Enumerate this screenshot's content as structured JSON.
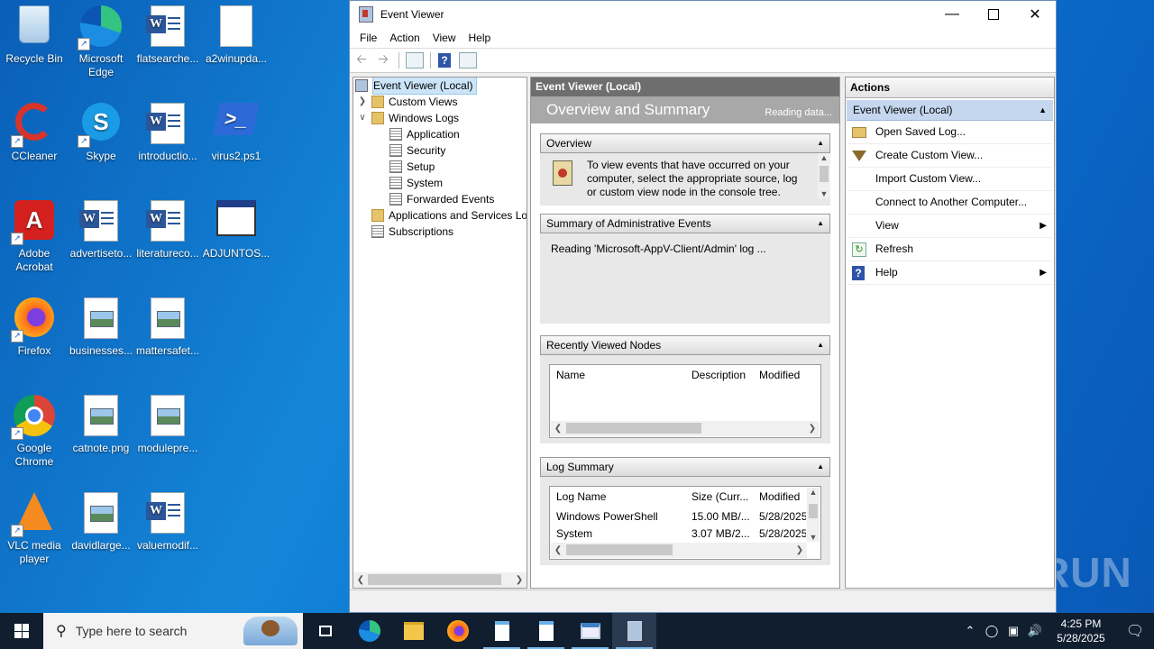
{
  "desktop": {
    "icons": [
      {
        "label": "Recycle Bin"
      },
      {
        "label": "Microsoft Edge"
      },
      {
        "label": "flatsearche..."
      },
      {
        "label": "a2winupda..."
      },
      {
        "label": "CCleaner"
      },
      {
        "label": "Skype"
      },
      {
        "label": "introductio..."
      },
      {
        "label": "virus2.ps1"
      },
      {
        "label": "Adobe Acrobat"
      },
      {
        "label": "advertiseto..."
      },
      {
        "label": "literatureco..."
      },
      {
        "label": "ADJUNTOS..."
      },
      {
        "label": "Firefox"
      },
      {
        "label": "businesses..."
      },
      {
        "label": "mattersafet..."
      },
      {
        "label": "Google Chrome"
      },
      {
        "label": "catnote.png"
      },
      {
        "label": "modulepre..."
      },
      {
        "label": "VLC media player"
      },
      {
        "label": "davidlarge..."
      },
      {
        "label": "valuemodif..."
      }
    ],
    "watermark": "ANY RUN"
  },
  "window": {
    "title": "Event Viewer",
    "menu": [
      "File",
      "Action",
      "View",
      "Help"
    ],
    "tree": {
      "root": "Event Viewer (Local)",
      "custom_views": "Custom Views",
      "windows_logs": "Windows Logs",
      "logs": [
        "Application",
        "Security",
        "Setup",
        "System",
        "Forwarded Events"
      ],
      "apps_services": "Applications and Services Lo",
      "subscriptions": "Subscriptions"
    },
    "center": {
      "header": "Event Viewer (Local)",
      "banner_title": "Overview and Summary",
      "banner_status": "Reading data...",
      "overview": {
        "title": "Overview",
        "text": "To view events that have occurred on your computer, select the appropriate source, log or custom view node in the console tree."
      },
      "admin_summary": {
        "title": "Summary of Administrative Events",
        "text": "Reading 'Microsoft-AppV-Client/Admin' log ..."
      },
      "recent": {
        "title": "Recently Viewed Nodes",
        "columns": [
          "Name",
          "Description",
          "Modified"
        ]
      },
      "log_summary": {
        "title": "Log Summary",
        "columns": [
          "Log Name",
          "Size (Curr...",
          "Modified"
        ],
        "rows": [
          [
            "Windows PowerShell",
            "15.00 MB/...",
            "5/28/2025"
          ],
          [
            "System",
            "3.07 MB/2...",
            "5/28/2025"
          ]
        ]
      }
    },
    "actions": {
      "header": "Actions",
      "section": "Event Viewer (Local)",
      "items": [
        {
          "label": "Open Saved Log...",
          "icon": "folder-open-icon"
        },
        {
          "label": "Create Custom View...",
          "icon": "filter-icon"
        },
        {
          "label": "Import Custom View...",
          "icon": ""
        },
        {
          "label": "Connect to Another Computer...",
          "icon": ""
        },
        {
          "label": "View",
          "icon": "",
          "submenu": true
        },
        {
          "label": "Refresh",
          "icon": "refresh-icon"
        },
        {
          "label": "Help",
          "icon": "help-icon",
          "submenu": true
        }
      ]
    }
  },
  "taskbar": {
    "search_placeholder": "Type here to search",
    "time": "4:25 PM",
    "date": "5/28/2025"
  }
}
